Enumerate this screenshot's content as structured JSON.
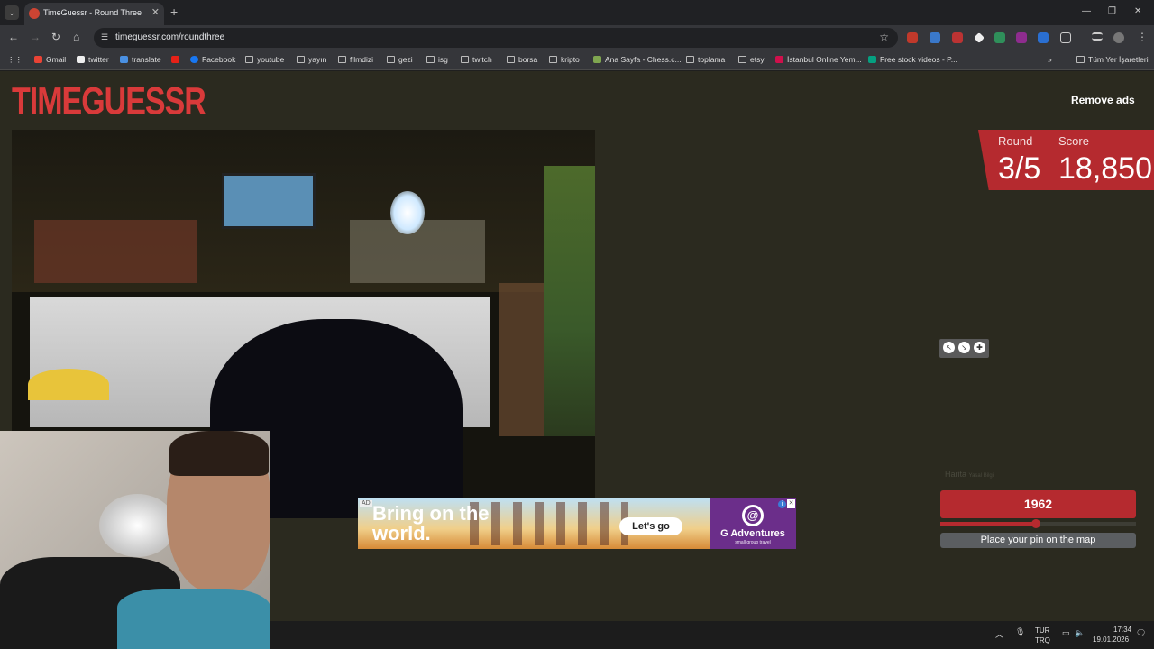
{
  "browser": {
    "tab_title": "TimeGuessr - Round Three",
    "tab_close": "✕",
    "new_tab": "+",
    "tab_menu": "⌄",
    "url": "timeguessr.com/roundthree",
    "window_controls": [
      "—",
      "❐",
      "✕"
    ],
    "bookmarks": [
      "Gmail",
      "twitter",
      "translate",
      "Facebook",
      "youtube",
      "yayın",
      "filmdizi",
      "gezi",
      "isg",
      "twitch",
      "borsa",
      "kripto",
      "Ana Sayfa - Chess.c...",
      "toplama",
      "etsy",
      "İstanbul Online Yem...",
      "Free stock videos - P..."
    ],
    "bookmarks_overflow": "»",
    "all_bookmarks": "Tüm Yer İşaretleri"
  },
  "page": {
    "logo": "TIMEGUESSR",
    "remove_ads": "Remove ads",
    "round_label": "Round",
    "round_value": "3/5",
    "score_label": "Score",
    "score_value": "18,850",
    "map_brand": "Harita",
    "map_brand_sub": "Yasal Bilgi",
    "year": "1962",
    "year_slider_fraction": 0.49,
    "place_pin": "Place your pin on the map"
  },
  "ad": {
    "label": "AD",
    "headline": "Bring on the world.",
    "cta": "Let's go",
    "brand": "G Adventures",
    "brand_sub": "small group travel",
    "brand_logo": "@",
    "info": "i",
    "close": "✕"
  },
  "taskbar": {
    "lang_top": "TUR",
    "lang_bottom": "TRQ",
    "time": "17:34",
    "date": "19.01.2026"
  },
  "colors": {
    "accent": "#b52a2f",
    "logo": "#d93a3a",
    "page_bg": "#2b2a1f"
  }
}
